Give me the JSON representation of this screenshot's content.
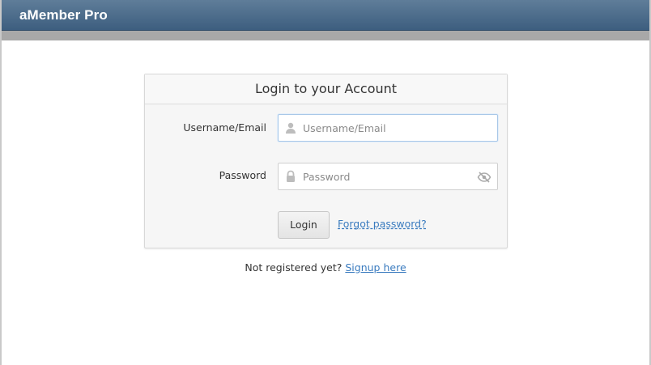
{
  "header": {
    "app_title": "aMember Pro"
  },
  "login": {
    "heading": "Login to your Account",
    "username_label": "Username/Email",
    "username_placeholder": "Username/Email",
    "password_label": "Password",
    "password_placeholder": "Password",
    "login_button": "Login",
    "forgot_link": "Forgot password?"
  },
  "signup": {
    "prompt": "Not registered yet?",
    "link": "Signup here"
  },
  "colors": {
    "header_top": "#5f7d99",
    "header_bottom": "#3d5e7f",
    "link": "#3a7bbf",
    "grey_bar": "#a8a8a8"
  },
  "icons": [
    "user-icon",
    "lock-icon",
    "eye-slash-icon"
  ]
}
